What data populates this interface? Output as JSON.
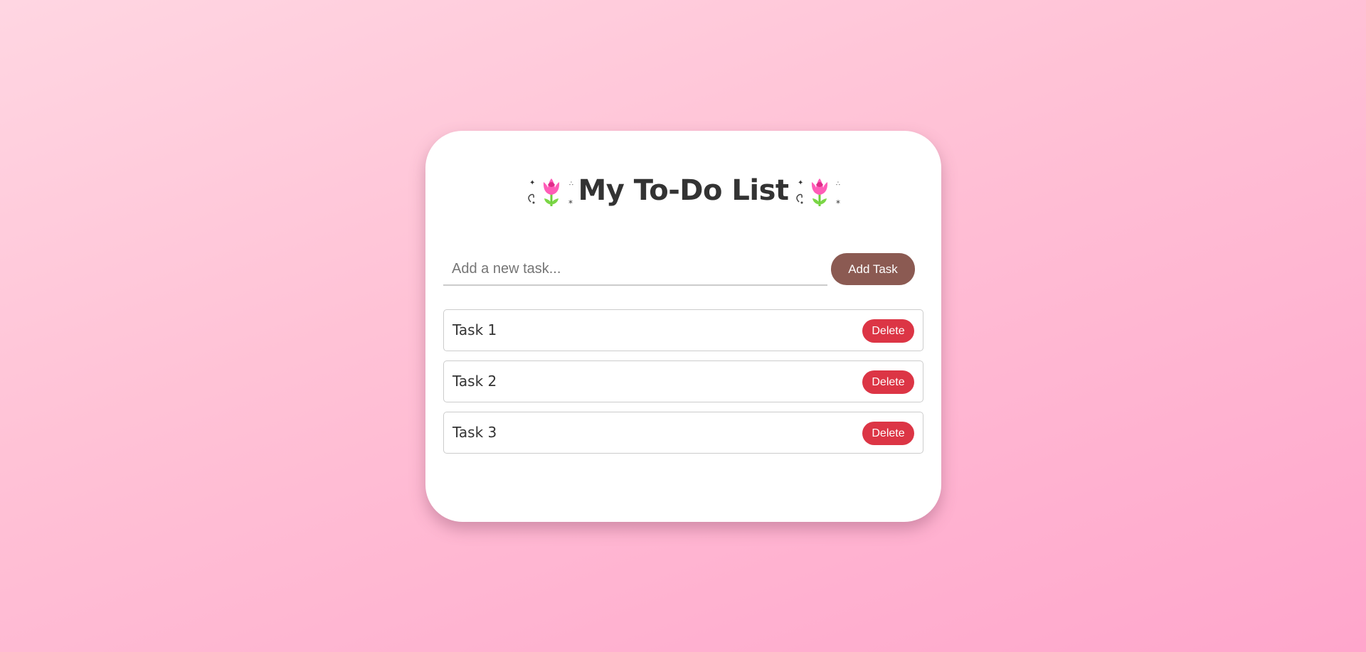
{
  "app": {
    "title": "My To-Do List",
    "decoration_icon": "tulip-icon"
  },
  "colors": {
    "accent_add": "#8b5a52",
    "accent_delete": "#dc3545",
    "title_text": "#333333"
  },
  "input": {
    "placeholder": "Add a new task...",
    "value": "",
    "add_label": "Add Task"
  },
  "tasks": [
    {
      "label": "Task 1",
      "delete_label": "Delete"
    },
    {
      "label": "Task 2",
      "delete_label": "Delete"
    },
    {
      "label": "Task 3",
      "delete_label": "Delete"
    }
  ]
}
